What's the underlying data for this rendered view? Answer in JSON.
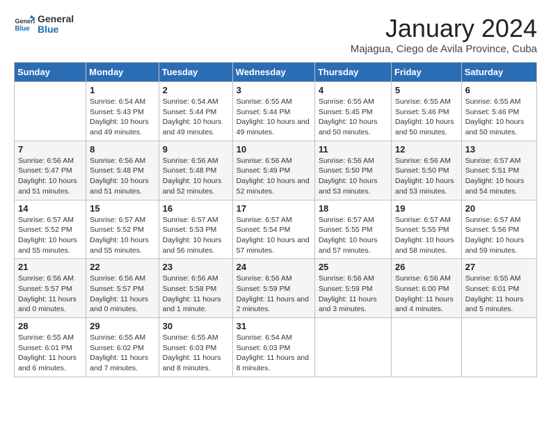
{
  "header": {
    "logo_general": "General",
    "logo_blue": "Blue",
    "month_title": "January 2024",
    "location": "Majagua, Ciego de Avila Province, Cuba"
  },
  "weekdays": [
    "Sunday",
    "Monday",
    "Tuesday",
    "Wednesday",
    "Thursday",
    "Friday",
    "Saturday"
  ],
  "weeks": [
    [
      {
        "day": "",
        "sunrise": "",
        "sunset": "",
        "daylight": ""
      },
      {
        "day": "1",
        "sunrise": "Sunrise: 6:54 AM",
        "sunset": "Sunset: 5:43 PM",
        "daylight": "Daylight: 10 hours and 49 minutes."
      },
      {
        "day": "2",
        "sunrise": "Sunrise: 6:54 AM",
        "sunset": "Sunset: 5:44 PM",
        "daylight": "Daylight: 10 hours and 49 minutes."
      },
      {
        "day": "3",
        "sunrise": "Sunrise: 6:55 AM",
        "sunset": "Sunset: 5:44 PM",
        "daylight": "Daylight: 10 hours and 49 minutes."
      },
      {
        "day": "4",
        "sunrise": "Sunrise: 6:55 AM",
        "sunset": "Sunset: 5:45 PM",
        "daylight": "Daylight: 10 hours and 50 minutes."
      },
      {
        "day": "5",
        "sunrise": "Sunrise: 6:55 AM",
        "sunset": "Sunset: 5:46 PM",
        "daylight": "Daylight: 10 hours and 50 minutes."
      },
      {
        "day": "6",
        "sunrise": "Sunrise: 6:55 AM",
        "sunset": "Sunset: 5:46 PM",
        "daylight": "Daylight: 10 hours and 50 minutes."
      }
    ],
    [
      {
        "day": "7",
        "sunrise": "Sunrise: 6:56 AM",
        "sunset": "Sunset: 5:47 PM",
        "daylight": "Daylight: 10 hours and 51 minutes."
      },
      {
        "day": "8",
        "sunrise": "Sunrise: 6:56 AM",
        "sunset": "Sunset: 5:48 PM",
        "daylight": "Daylight: 10 hours and 51 minutes."
      },
      {
        "day": "9",
        "sunrise": "Sunrise: 6:56 AM",
        "sunset": "Sunset: 5:48 PM",
        "daylight": "Daylight: 10 hours and 52 minutes."
      },
      {
        "day": "10",
        "sunrise": "Sunrise: 6:56 AM",
        "sunset": "Sunset: 5:49 PM",
        "daylight": "Daylight: 10 hours and 52 minutes."
      },
      {
        "day": "11",
        "sunrise": "Sunrise: 6:56 AM",
        "sunset": "Sunset: 5:50 PM",
        "daylight": "Daylight: 10 hours and 53 minutes."
      },
      {
        "day": "12",
        "sunrise": "Sunrise: 6:56 AM",
        "sunset": "Sunset: 5:50 PM",
        "daylight": "Daylight: 10 hours and 53 minutes."
      },
      {
        "day": "13",
        "sunrise": "Sunrise: 6:57 AM",
        "sunset": "Sunset: 5:51 PM",
        "daylight": "Daylight: 10 hours and 54 minutes."
      }
    ],
    [
      {
        "day": "14",
        "sunrise": "Sunrise: 6:57 AM",
        "sunset": "Sunset: 5:52 PM",
        "daylight": "Daylight: 10 hours and 55 minutes."
      },
      {
        "day": "15",
        "sunrise": "Sunrise: 6:57 AM",
        "sunset": "Sunset: 5:52 PM",
        "daylight": "Daylight: 10 hours and 55 minutes."
      },
      {
        "day": "16",
        "sunrise": "Sunrise: 6:57 AM",
        "sunset": "Sunset: 5:53 PM",
        "daylight": "Daylight: 10 hours and 56 minutes."
      },
      {
        "day": "17",
        "sunrise": "Sunrise: 6:57 AM",
        "sunset": "Sunset: 5:54 PM",
        "daylight": "Daylight: 10 hours and 57 minutes."
      },
      {
        "day": "18",
        "sunrise": "Sunrise: 6:57 AM",
        "sunset": "Sunset: 5:55 PM",
        "daylight": "Daylight: 10 hours and 57 minutes."
      },
      {
        "day": "19",
        "sunrise": "Sunrise: 6:57 AM",
        "sunset": "Sunset: 5:55 PM",
        "daylight": "Daylight: 10 hours and 58 minutes."
      },
      {
        "day": "20",
        "sunrise": "Sunrise: 6:57 AM",
        "sunset": "Sunset: 5:56 PM",
        "daylight": "Daylight: 10 hours and 59 minutes."
      }
    ],
    [
      {
        "day": "21",
        "sunrise": "Sunrise: 6:56 AM",
        "sunset": "Sunset: 5:57 PM",
        "daylight": "Daylight: 11 hours and 0 minutes."
      },
      {
        "day": "22",
        "sunrise": "Sunrise: 6:56 AM",
        "sunset": "Sunset: 5:57 PM",
        "daylight": "Daylight: 11 hours and 0 minutes."
      },
      {
        "day": "23",
        "sunrise": "Sunrise: 6:56 AM",
        "sunset": "Sunset: 5:58 PM",
        "daylight": "Daylight: 11 hours and 1 minute."
      },
      {
        "day": "24",
        "sunrise": "Sunrise: 6:56 AM",
        "sunset": "Sunset: 5:59 PM",
        "daylight": "Daylight: 11 hours and 2 minutes."
      },
      {
        "day": "25",
        "sunrise": "Sunrise: 6:56 AM",
        "sunset": "Sunset: 5:59 PM",
        "daylight": "Daylight: 11 hours and 3 minutes."
      },
      {
        "day": "26",
        "sunrise": "Sunrise: 6:56 AM",
        "sunset": "Sunset: 6:00 PM",
        "daylight": "Daylight: 11 hours and 4 minutes."
      },
      {
        "day": "27",
        "sunrise": "Sunrise: 6:55 AM",
        "sunset": "Sunset: 6:01 PM",
        "daylight": "Daylight: 11 hours and 5 minutes."
      }
    ],
    [
      {
        "day": "28",
        "sunrise": "Sunrise: 6:55 AM",
        "sunset": "Sunset: 6:01 PM",
        "daylight": "Daylight: 11 hours and 6 minutes."
      },
      {
        "day": "29",
        "sunrise": "Sunrise: 6:55 AM",
        "sunset": "Sunset: 6:02 PM",
        "daylight": "Daylight: 11 hours and 7 minutes."
      },
      {
        "day": "30",
        "sunrise": "Sunrise: 6:55 AM",
        "sunset": "Sunset: 6:03 PM",
        "daylight": "Daylight: 11 hours and 8 minutes."
      },
      {
        "day": "31",
        "sunrise": "Sunrise: 6:54 AM",
        "sunset": "Sunset: 6:03 PM",
        "daylight": "Daylight: 11 hours and 8 minutes."
      },
      {
        "day": "",
        "sunrise": "",
        "sunset": "",
        "daylight": ""
      },
      {
        "day": "",
        "sunrise": "",
        "sunset": "",
        "daylight": ""
      },
      {
        "day": "",
        "sunrise": "",
        "sunset": "",
        "daylight": ""
      }
    ]
  ]
}
